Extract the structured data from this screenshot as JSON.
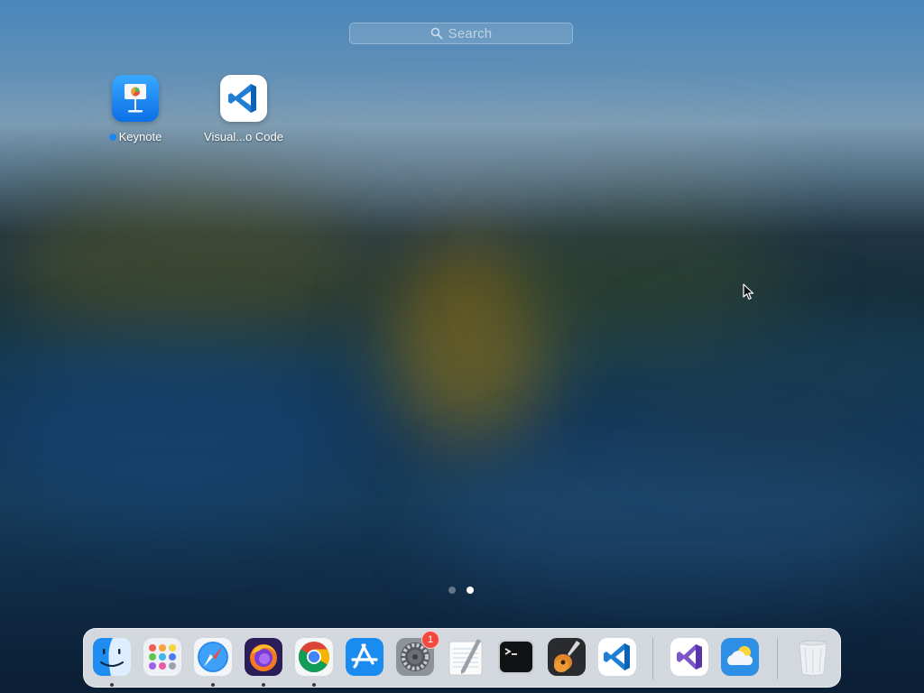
{
  "search": {
    "placeholder": "Search"
  },
  "apps": [
    {
      "name": "Keynote",
      "new": true
    },
    {
      "name": "Visual...o Code",
      "new": false
    }
  ],
  "pagination": {
    "pages": 2,
    "current": 2
  },
  "dock": {
    "items": [
      {
        "name": "Finder",
        "icon": "finder-icon",
        "running": true
      },
      {
        "name": "Launchpad",
        "icon": "launchpad-icon",
        "running": false
      },
      {
        "name": "Safari",
        "icon": "safari-icon",
        "running": true
      },
      {
        "name": "Firefox",
        "icon": "firefox-icon",
        "running": true
      },
      {
        "name": "Google Chrome",
        "icon": "chrome-icon",
        "running": true
      },
      {
        "name": "App Store",
        "icon": "app-store-icon",
        "running": false
      },
      {
        "name": "System Preferences",
        "icon": "system-preferences-icon",
        "running": false,
        "badge": "1"
      },
      {
        "name": "TextEdit",
        "icon": "textedit-icon",
        "running": false
      },
      {
        "name": "Terminal",
        "icon": "terminal-icon",
        "running": false
      },
      {
        "name": "GarageBand",
        "icon": "garageband-icon",
        "running": false
      },
      {
        "name": "Visual Studio Code",
        "icon": "vscode-icon",
        "running": false
      },
      {
        "name": "Visual Studio",
        "icon": "visual-studio-icon",
        "running": false
      },
      {
        "name": "Weather",
        "icon": "weather-icon",
        "running": false
      },
      {
        "name": "Trash",
        "icon": "trash-icon",
        "running": false
      }
    ]
  },
  "colors": {
    "accent": "#1e86f2",
    "badge": "#f04a3e"
  }
}
